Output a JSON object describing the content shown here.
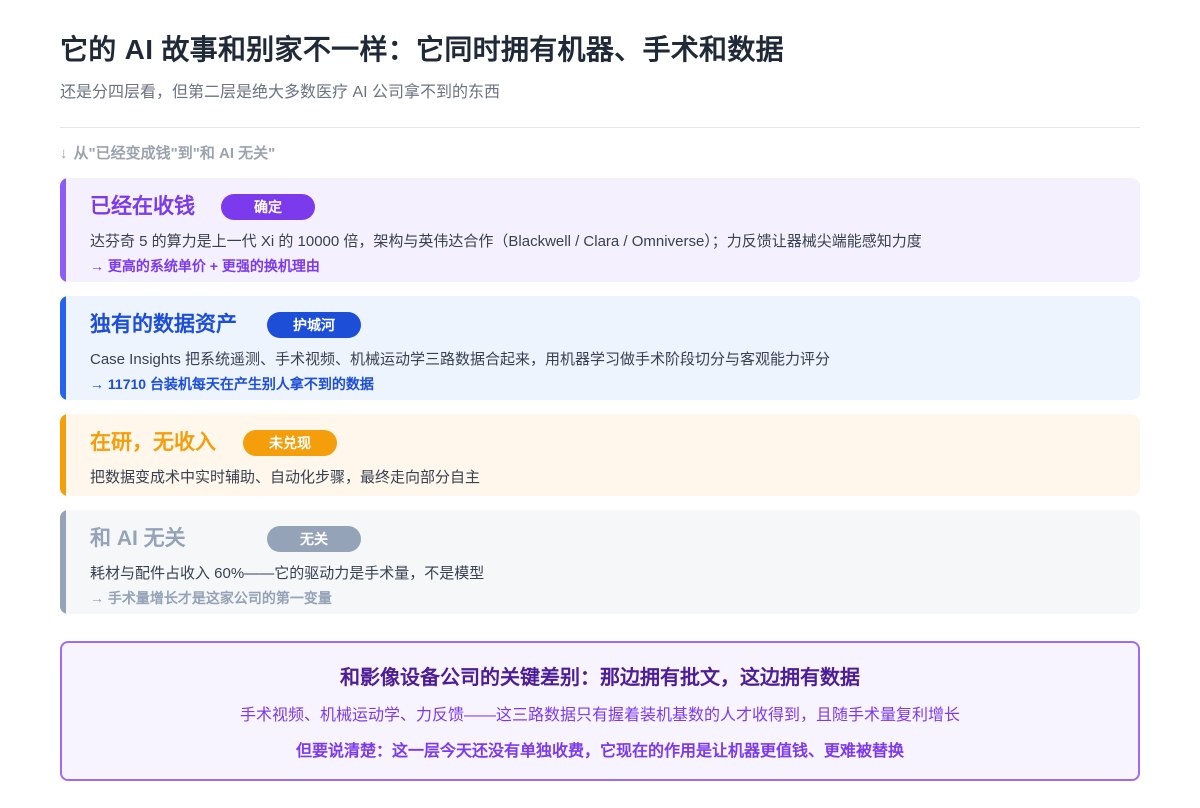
{
  "header": {
    "title": "它的 AI 故事和别家不一样：它同时拥有机器、手术和数据",
    "subtitle": "还是分四层看，但第二层是绝大多数医疗 AI 公司拿不到的东西"
  },
  "axis_note": {
    "arrow": "↓",
    "text": "从\"已经变成钱\"到\"和 AI 无关\""
  },
  "layers": [
    {
      "title": "已经在收钱",
      "badge": "确定",
      "description": "达芬奇 5 的算力是上一代 Xi 的 10000 倍，架构与英伟达合作（Blackwell / Clara / Omniverse）；力反馈让器械尖端能感知力度",
      "note": "→ 更高的系统单价 + 更强的换机理由",
      "accent": "#7c3aed"
    },
    {
      "title": "独有的数据资产",
      "badge": "护城河",
      "description": "Case Insights 把系统遥测、手术视频、机械运动学三路数据合起来，用机器学习做手术阶段切分与客观能力评分",
      "note": "→ 11710 台装机每天在产生别人拿不到的数据",
      "accent": "#1d4ed8"
    },
    {
      "title": "在研，无收入",
      "badge": "未兑现",
      "description": "把数据变成术中实时辅助、自动化步骤，最终走向部分自主",
      "accent": "#f59e0b"
    },
    {
      "title": "和 AI 无关",
      "badge": "无关",
      "description": "耗材与配件占收入 60%——它的驱动力是手术量，不是模型",
      "note": "→ 手术量增长才是这家公司的第一变量",
      "accent": "#94a3b8"
    }
  ],
  "callout": {
    "title": "和影像设备公司的关键差别：那边拥有批文，这边拥有数据",
    "line1": "手术视频、机械运动学、力反馈——这三路数据只有握着装机基数的人才收得到，且随手术量复利增长",
    "line2": "但要说清楚：这一层今天还没有单独收费，它现在的作用是让机器更值钱、更难被替换"
  }
}
